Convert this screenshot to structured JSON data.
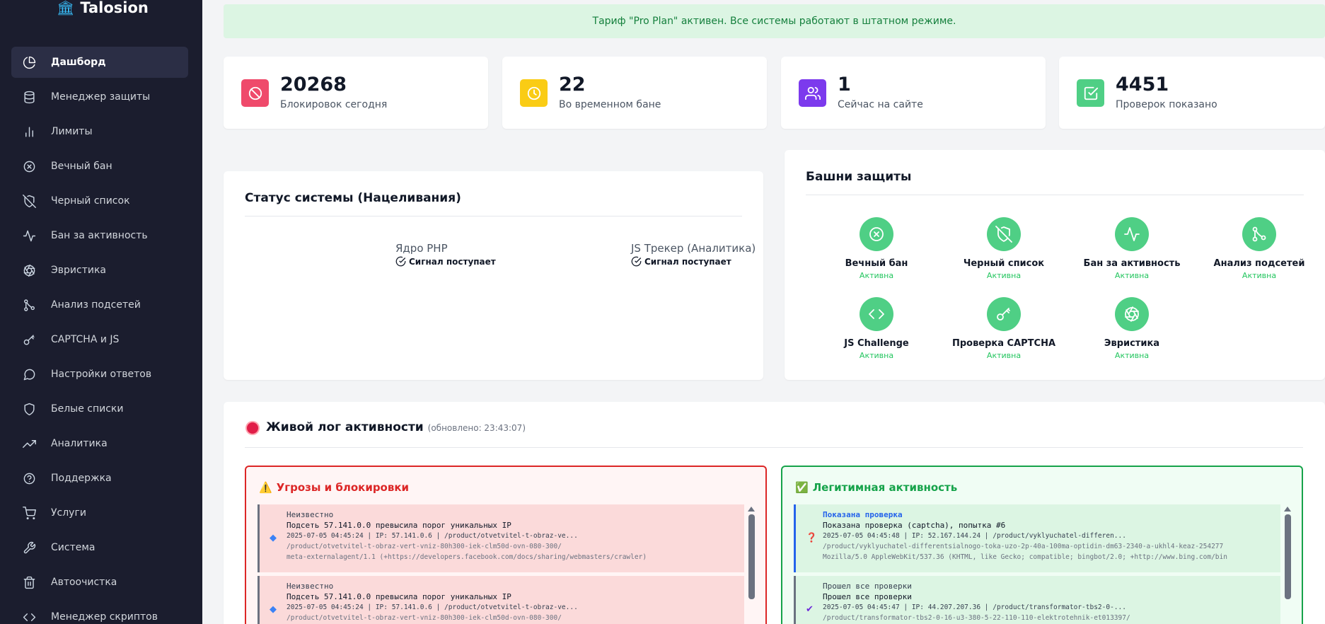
{
  "brand": {
    "name": "Talosion",
    "icon": "castle-icon"
  },
  "sidebar": {
    "items": [
      {
        "label": "Дашборд",
        "icon": "pie-chart-icon",
        "active": true
      },
      {
        "label": "Менеджер защиты",
        "icon": "database-icon"
      },
      {
        "label": "Лимиты",
        "icon": "bar-chart-icon"
      },
      {
        "label": "Вечный бан",
        "icon": "x-circle-icon"
      },
      {
        "label": "Черный список",
        "icon": "shield-off-icon"
      },
      {
        "label": "Бан за активность",
        "icon": "activity-icon"
      },
      {
        "label": "Эвристика",
        "icon": "aperture-icon"
      },
      {
        "label": "Анализ подсетей",
        "icon": "git-branch-icon"
      },
      {
        "label": "CAPTCHA и JS",
        "icon": "key-icon"
      },
      {
        "label": "Настройки ответов",
        "icon": "message-circle-icon"
      },
      {
        "label": "Белые списки",
        "icon": "shield-icon"
      },
      {
        "label": "Аналитика",
        "icon": "trending-up-icon"
      },
      {
        "label": "Поддержка",
        "icon": "help-circle-icon"
      },
      {
        "label": "Услуги",
        "icon": "shopping-cart-icon"
      },
      {
        "label": "Система",
        "icon": "tool-icon"
      },
      {
        "label": "Автоочистка",
        "icon": "trash-icon"
      },
      {
        "label": "Менеджер скриптов",
        "icon": "code-icon"
      }
    ]
  },
  "banner": {
    "text": "Тариф \"Pro Plan\" активен. Все системы работают в штатном режиме."
  },
  "stats": [
    {
      "value": "20268",
      "label": "Блокировок сегодня",
      "color": "#ef4a6b",
      "icon": "ban-icon"
    },
    {
      "value": "22",
      "label": "Во временном бане",
      "color": "#facc15",
      "icon": "clock-icon"
    },
    {
      "value": "1",
      "label": "Сейчас на сайте",
      "color": "#7c3aed",
      "icon": "users-icon"
    },
    {
      "value": "4451",
      "label": "Проверок показано",
      "color": "#4fcf85",
      "icon": "check-square-icon"
    }
  ],
  "system_status": {
    "title": "Статус системы (Нацеливания)",
    "signals": [
      {
        "name": "Ядро PHP",
        "status": "Сигнал поступает"
      },
      {
        "name": "JS Трекер (Аналитика)",
        "status": "Сигнал поступает"
      }
    ]
  },
  "towers": {
    "title": "Башни защиты",
    "items": [
      {
        "name": "Вечный бан",
        "status": "Активна",
        "icon": "x-circle-icon"
      },
      {
        "name": "Черный список",
        "status": "Активна",
        "icon": "shield-off-icon"
      },
      {
        "name": "Бан за активность",
        "status": "Активна",
        "icon": "activity-icon"
      },
      {
        "name": "Анализ подсетей",
        "status": "Активна",
        "icon": "git-branch-icon"
      },
      {
        "name": "JS Challenge",
        "status": "Активна",
        "icon": "code-icon"
      },
      {
        "name": "Проверка CAPTCHA",
        "status": "Активна",
        "icon": "key-icon"
      },
      {
        "name": "Эвристика",
        "status": "Активна",
        "icon": "aperture-icon"
      }
    ]
  },
  "live_log": {
    "title": "Живой лог активности",
    "updated": "(обновлено: 23:43:07)",
    "threats": {
      "title": "Угрозы и блокировки",
      "icon": "warning-icon",
      "entries": [
        {
          "type": "Неизвестно",
          "message": "Подсеть 57.141.0.0 превысила порог уникальных IP",
          "meta": "2025-07-05 04:45:24 | IP: 57.141.0.6 | /product/otvetvitel-t-obraz-ve...",
          "url": "/product/otvetvitel-t-obraz-vert-vniz-80h300-iek-clm50d-ovn-080-300/",
          "ua": "meta-externalagent/1.1 (+https://developers.facebook.com/docs/sharing/webmasters/crawler)",
          "mark": "◆"
        },
        {
          "type": "Неизвестно",
          "message": "Подсеть 57.141.0.0 превысила порог уникальных IP",
          "meta": "2025-07-05 04:45:24 | IP: 57.141.0.6 | /product/otvetvitel-t-obraz-ve...",
          "url": "/product/otvetvitel-t-obraz-vert-vniz-80h300-iek-clm50d-ovn-080-300/",
          "ua": "",
          "mark": "◆"
        }
      ]
    },
    "legit": {
      "title": "Легитимная активность",
      "icon": "check-box-icon",
      "entries": [
        {
          "type": "Показана проверка",
          "message": "Показана проверка (captcha), попытка #6",
          "meta": "2025-07-05 04:45:48 | IP: 52.167.144.24 | /product/vyklyuchatel-differen...",
          "url": "/product/vyklyuchatel-differentsialnogo-toka-uzo-2p-40a-100ma-optidin-dm63-2340-a-ukhl4-keaz-254277",
          "ua": "Mozilla/5.0 AppleWebKit/537.36 (KHTML, like Gecko; compatible; bingbot/2.0; +http://www.bing.com/bin",
          "mark": "❓"
        },
        {
          "type": "Прошел все проверки",
          "message": "Прошел все проверки",
          "meta": "2025-07-05 04:45:47 | IP: 44.207.207.36 | /product/transformator-tbs2-0-...",
          "url": "/product/transformator-tbs2-0-16-u3-380-5-22-110-110-elektrotehnik-et013397/",
          "ua": "",
          "mark": "✔"
        }
      ]
    }
  }
}
